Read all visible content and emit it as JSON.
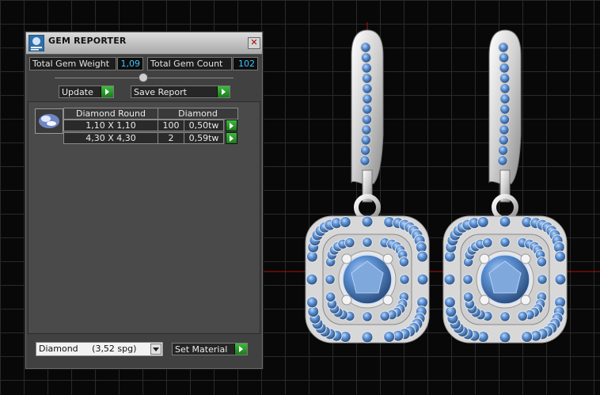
{
  "window": {
    "title": "GEM REPORTER",
    "close_glyph": "✕"
  },
  "stats": {
    "weight_label": "Total Gem Weight",
    "weight_value": "1,09",
    "count_label": "Total Gem Count",
    "count_value": "102"
  },
  "buttons": {
    "update_label": "Update",
    "save_report_label": "Save Report",
    "set_material_label": "Set Material"
  },
  "gem_table": {
    "headers": [
      "Diamond Round",
      "Diamond"
    ],
    "rows": [
      {
        "size": "1,10 X 1,10",
        "count": "100",
        "weight": "0,50tw"
      },
      {
        "size": "4,30 X 4,30",
        "count": "2",
        "weight": "0,59tw"
      }
    ]
  },
  "material": {
    "selected": "Diamond     (3,52 spg)"
  },
  "viewport": {
    "gem_color": "#5b8fd0",
    "metal_color": "#e4e4e4",
    "axis_color": "#b01010",
    "grid_color": "#2a2a2a"
  },
  "icons": {
    "app": "gem-reporter-app-icon",
    "thumbnail": "diamond-round-thumbnail-icon",
    "arrow": "green-play-arrow-icon",
    "dropdown": "chevron-down-icon",
    "slider": "slider-knob-icon",
    "close": "close-icon"
  }
}
